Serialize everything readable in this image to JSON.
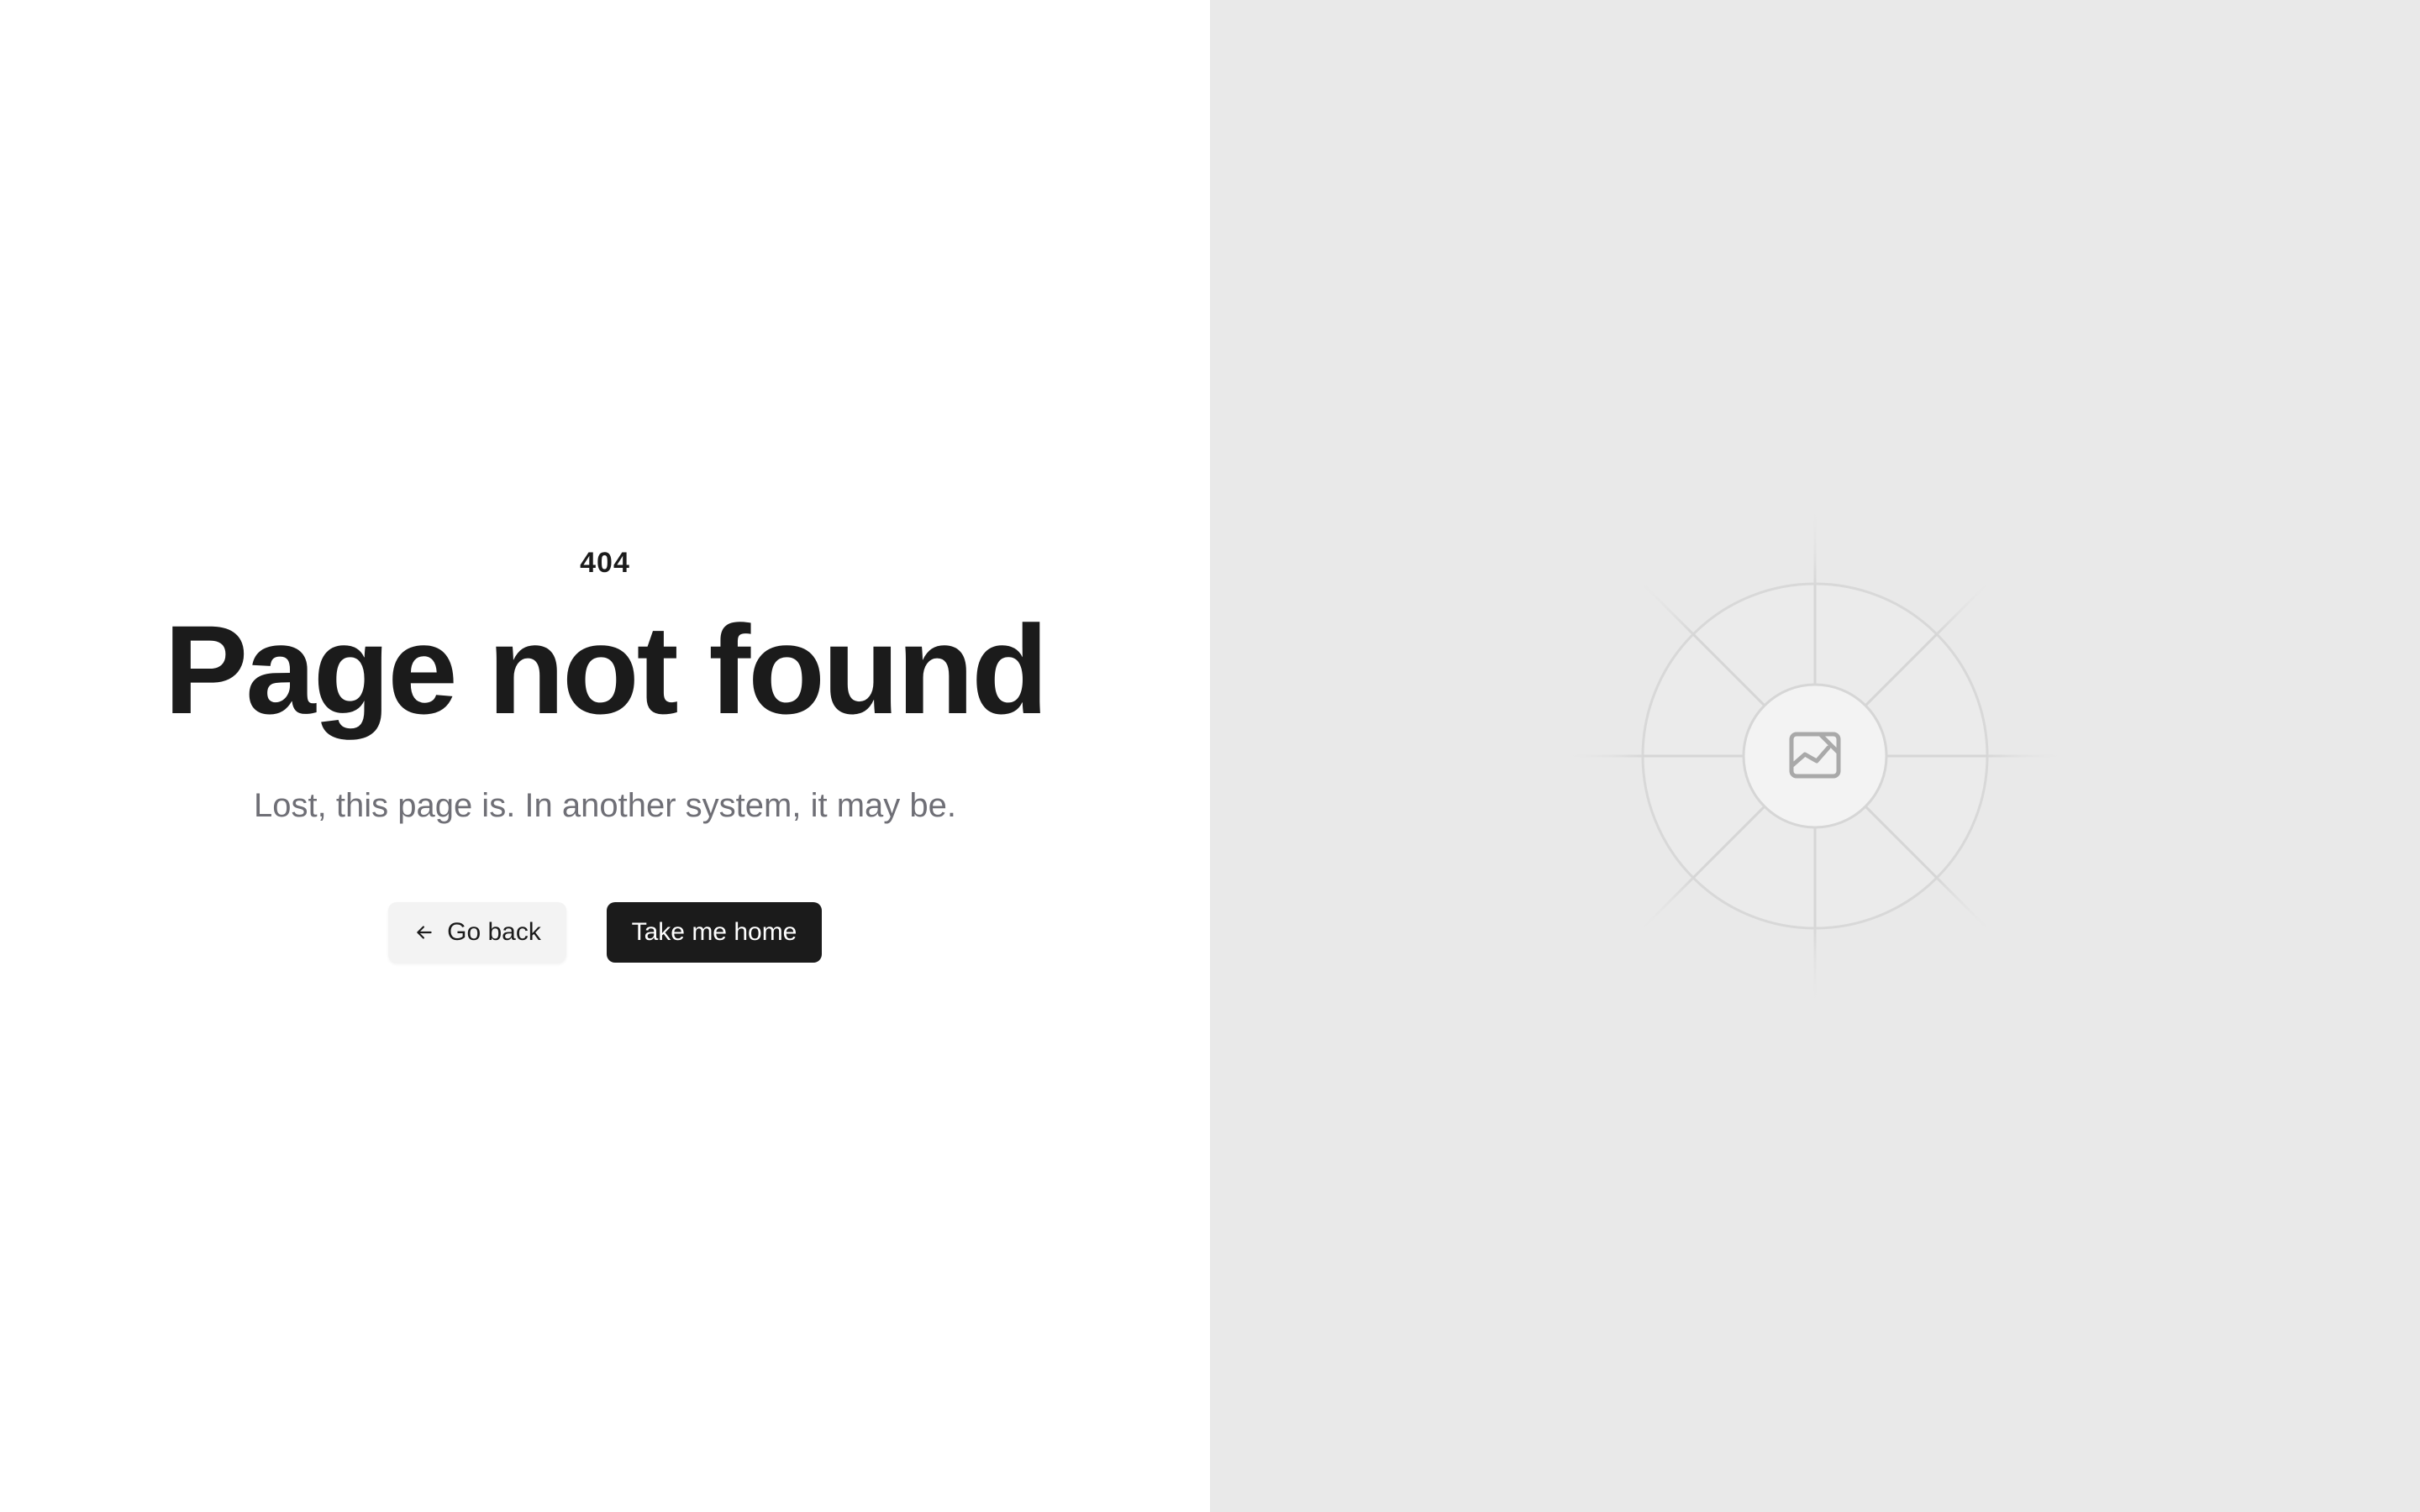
{
  "error": {
    "code": "404",
    "title": "Page not found",
    "message": "Lost, this page is. In another system, it may be."
  },
  "actions": {
    "back_label": "Go back",
    "home_label": "Take me home"
  },
  "illustration": {
    "icon": "image-icon",
    "background_color": "#e9e9e9"
  },
  "colors": {
    "primary_button": "#1b1b1b",
    "secondary_button": "#f3f3f3",
    "text": "#1b1b1b",
    "muted_text": "#6f6f76"
  }
}
